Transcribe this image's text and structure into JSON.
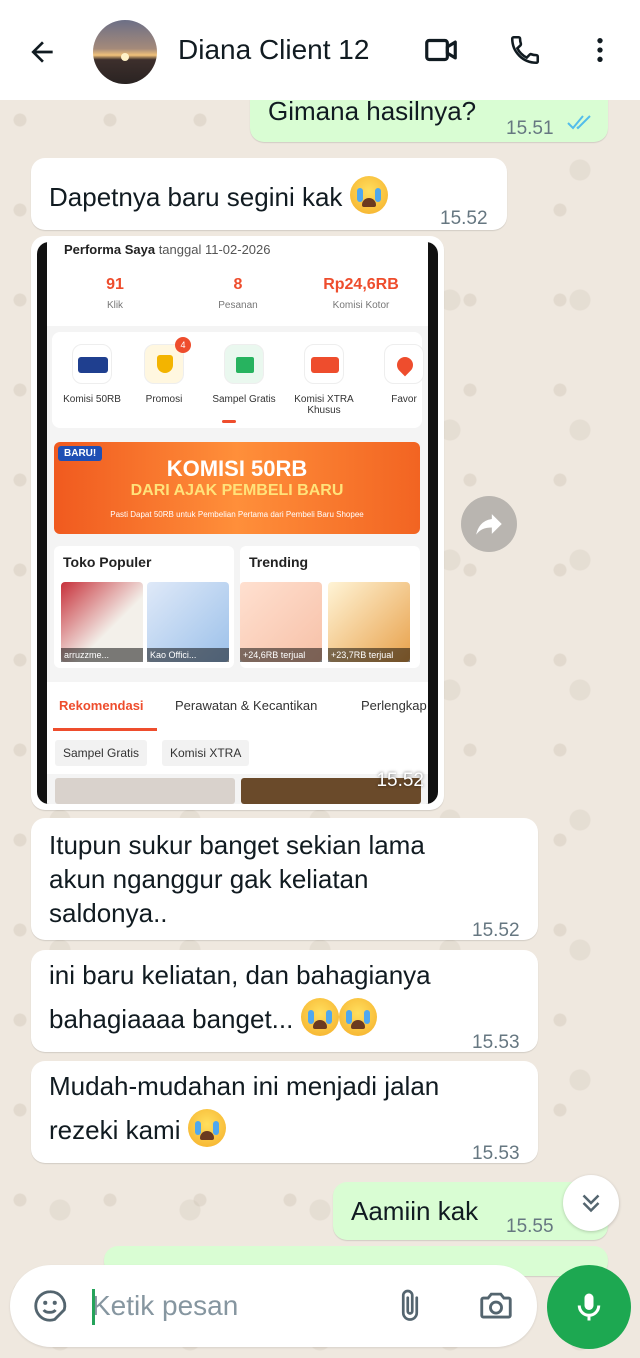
{
  "header": {
    "contact_name": "Diana Client 12",
    "icons": [
      "arrow-back-icon",
      "video-call-icon",
      "phone-call-icon",
      "more-vert-icon"
    ]
  },
  "messages": [
    {
      "dir": "out",
      "text": "Gimana hasilnya?",
      "time": "15.51",
      "read": true
    },
    {
      "dir": "in",
      "text": "Dapetnya baru segini kak",
      "emoji_count": 1,
      "time": "15.52"
    },
    {
      "dir": "in",
      "type": "image",
      "time": "15.52"
    },
    {
      "dir": "in",
      "text_lines": [
        "Itupun sukur banget sekian lama",
        "akun nganggur gak keliatan",
        "saldonya.."
      ],
      "time": "15.52"
    },
    {
      "dir": "in",
      "text_lines": [
        "ini baru keliatan, dan bahagianya",
        "bahagiaaaa banget..."
      ],
      "emoji_count": 2,
      "time": "15.53"
    },
    {
      "dir": "in",
      "text_lines": [
        "Mudah-mudahan ini menjadi jalan",
        "rezeki kami"
      ],
      "emoji_count": 1,
      "time": "15.53"
    },
    {
      "dir": "out",
      "text": "Aamiin kak",
      "time": "15.55",
      "read": true
    }
  ],
  "image_content": {
    "perf_title": "Performa Saya",
    "perf_date": "tanggal 11-02-2026",
    "stats": [
      {
        "value": "91",
        "label": "Klik"
      },
      {
        "value": "8",
        "label": "Pesanan"
      },
      {
        "value": "Rp24,6RB",
        "label": "Komisi Kotor"
      }
    ],
    "menu": [
      {
        "label": "Komisi 50RB",
        "badge": ""
      },
      {
        "label": "Promosi",
        "badge": "4"
      },
      {
        "label": "Sampel Gratis",
        "badge": ""
      },
      {
        "label": "Komisi XTRA Khusus",
        "badge": ""
      },
      {
        "label": "Favor",
        "badge": ""
      }
    ],
    "banner": {
      "tag": "BARU!",
      "line1": "KOMISI 50RB",
      "line2": "DARI AJAK PEMBELI BARU",
      "line3": "Pasti Dapat 50RB untuk Pembelian Pertama dari Pembeli Baru Shopee"
    },
    "toko_populer": {
      "title": "Toko Populer",
      "items": [
        "arruzzme...",
        "Kao Offici..."
      ]
    },
    "trending": {
      "title": "Trending",
      "items": [
        "+24,6RB terjual",
        "+23,7RB terjual"
      ]
    },
    "tabs": [
      "Rekomendasi",
      "Perawatan & Kecantikan",
      "Perlengkap"
    ],
    "chips": [
      "Sampel Gratis",
      "Komisi XTRA"
    ]
  },
  "composer": {
    "placeholder": "Ketik pesan"
  },
  "colors": {
    "outgoing": "#d9fdd3",
    "incoming": "#ffffff",
    "accent_green": "#1da851",
    "read_ticks": "#53bdeb"
  }
}
